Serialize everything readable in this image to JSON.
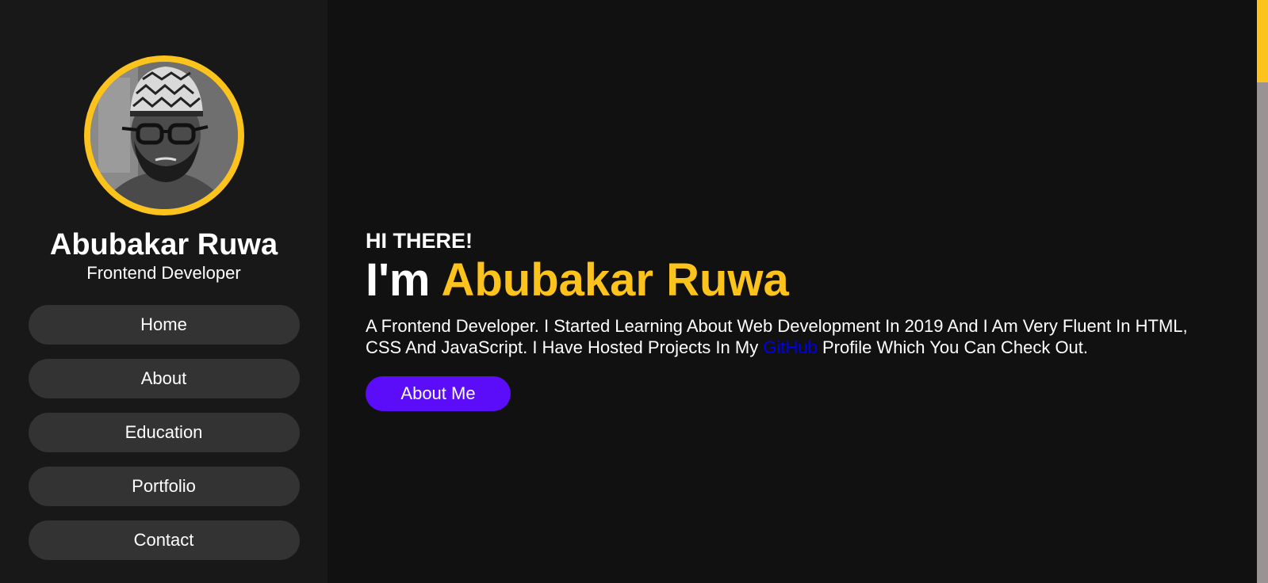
{
  "sidebar": {
    "profile_name": "Abubakar Ruwa",
    "profile_role": "Frontend Developer",
    "nav": [
      {
        "label": "Home"
      },
      {
        "label": "About"
      },
      {
        "label": "Education"
      },
      {
        "label": "Portfolio"
      },
      {
        "label": "Contact"
      }
    ]
  },
  "hero": {
    "greeting": "HI THERE!",
    "headline_prefix": "I'm",
    "headline_name": "Abubakar Ruwa",
    "intro_before_link": "A Frontend Developer. I Started Learning About Web Development In 2019 And I Am Very Fluent In HTML, CSS And JavaScript. I Have Hosted Projects In My",
    "intro_link": "GitHub",
    "intro_after_link": "Profile Which You Can Check Out.",
    "cta_label": "About Me"
  },
  "colors": {
    "accent": "#fcc31c",
    "button": "#5b0dfa",
    "link": "#0000ee",
    "sidebar_bg": "#181818",
    "main_bg": "#111111",
    "nav_bg": "#333333"
  },
  "scrollbar": {
    "position_fraction": 0.0
  }
}
